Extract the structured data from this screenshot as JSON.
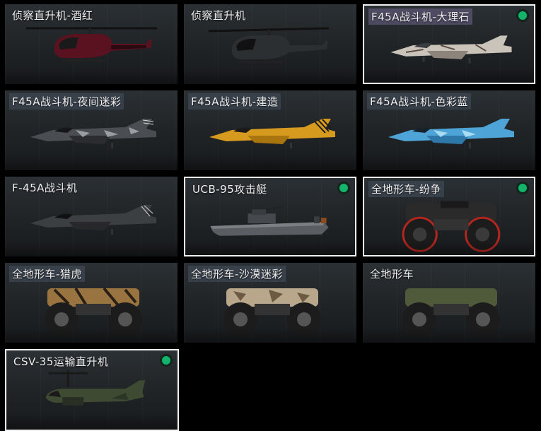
{
  "colors": {
    "selected_border": "#f2f2f2",
    "owned_dot": "#13b36b",
    "card_bg": "#23272a"
  },
  "items": [
    {
      "label": "侦察直升机-酒红",
      "vehicle": "helicopter",
      "scheme": "wine-red",
      "selected": false,
      "owned": false,
      "icon": "helicopter-icon"
    },
    {
      "label": "侦察直升机",
      "vehicle": "helicopter",
      "scheme": "dark",
      "selected": false,
      "owned": false,
      "icon": "helicopter-icon"
    },
    {
      "label": "F45A战斗机-大理石",
      "vehicle": "jet",
      "scheme": "marble",
      "selected": true,
      "owned": true,
      "icon": "fighter-jet-icon"
    },
    {
      "label": "F45A战斗机-夜间迷彩",
      "vehicle": "jet",
      "scheme": "night-camo",
      "selected": false,
      "owned": false,
      "icon": "fighter-jet-icon"
    },
    {
      "label": "F45A战斗机-建造",
      "vehicle": "jet",
      "scheme": "construction-yellow",
      "selected": false,
      "owned": false,
      "icon": "fighter-jet-icon"
    },
    {
      "label": "F45A战斗机-色彩蓝",
      "vehicle": "jet",
      "scheme": "blue-camo",
      "selected": false,
      "owned": false,
      "icon": "fighter-jet-icon"
    },
    {
      "label": "F-45A战斗机",
      "vehicle": "jet",
      "scheme": "grey",
      "selected": false,
      "owned": false,
      "icon": "fighter-jet-icon"
    },
    {
      "label": "UCB-95攻击艇",
      "vehicle": "boat",
      "scheme": "grey",
      "selected": true,
      "owned": true,
      "icon": "attack-boat-icon"
    },
    {
      "label": "全地形车-纷争",
      "vehicle": "atv",
      "scheme": "black-red",
      "selected": true,
      "owned": true,
      "icon": "atv-icon"
    },
    {
      "label": "全地形车-猎虎",
      "vehicle": "atv",
      "scheme": "tiger",
      "selected": false,
      "owned": false,
      "icon": "atv-icon"
    },
    {
      "label": "全地形车-沙漠迷彩",
      "vehicle": "atv",
      "scheme": "desert-camo",
      "selected": false,
      "owned": false,
      "icon": "atv-icon"
    },
    {
      "label": "全地形车",
      "vehicle": "atv",
      "scheme": "olive",
      "selected": false,
      "owned": false,
      "icon": "atv-icon"
    },
    {
      "label": "CSV-35运输直升机",
      "vehicle": "tiltrotor",
      "scheme": "olive",
      "selected": true,
      "owned": true,
      "icon": "transport-helicopter-icon"
    }
  ]
}
